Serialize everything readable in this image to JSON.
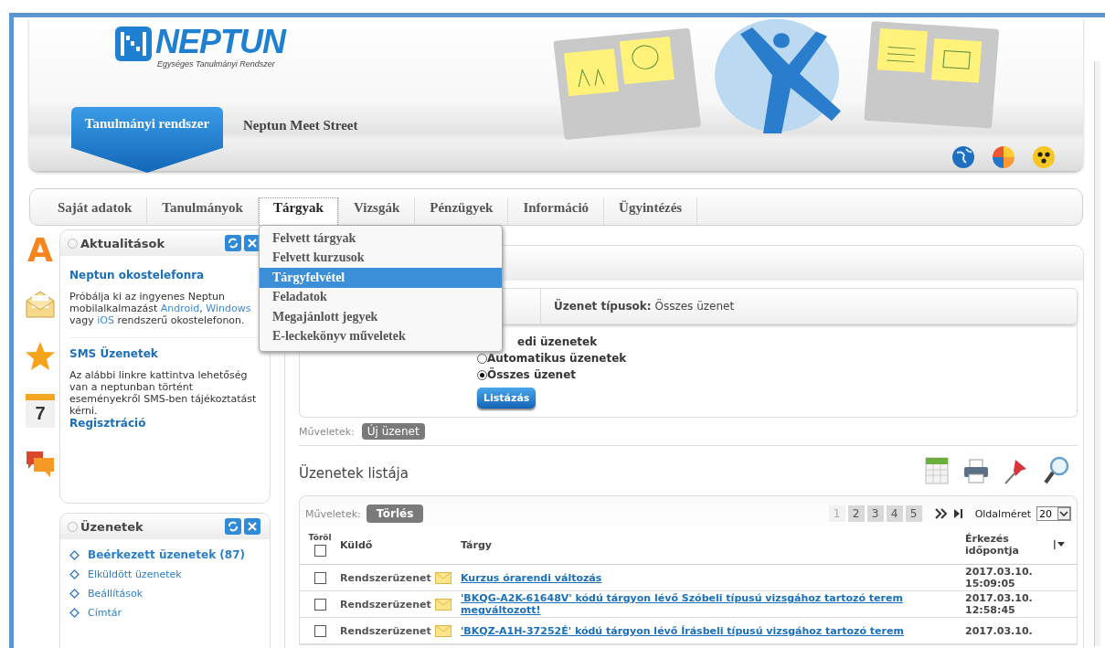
{
  "header": {
    "logo": {
      "name": "NEPTUN",
      "subtitle": "Egységes Tanulmányi Rendszer"
    },
    "tabs": [
      {
        "label": "Tanulmányi rendszer",
        "selected": true
      },
      {
        "label": "Neptun Meet Street",
        "selected": false
      }
    ]
  },
  "nav": {
    "items": [
      {
        "label": "Saját adatok",
        "selected": false
      },
      {
        "label": "Tanulmányok",
        "selected": false
      },
      {
        "label": "Tárgyak",
        "selected": true
      },
      {
        "label": "Vizsgák",
        "selected": false
      },
      {
        "label": "Pénzügyek",
        "selected": false
      },
      {
        "label": "Információ",
        "selected": false
      },
      {
        "label": "Ügyintézés",
        "selected": false
      }
    ],
    "menu": [
      {
        "label": "Felvett tárgyak",
        "selected": false
      },
      {
        "label": "Felvett kurzusok",
        "selected": false
      },
      {
        "label": "Tárgyfelvétel",
        "selected": true
      },
      {
        "label": "Feladatok",
        "selected": false
      },
      {
        "label": "Megajánlott jegyek",
        "selected": false
      },
      {
        "label": "E-leckekönyv műveletek",
        "selected": false
      }
    ]
  },
  "side_icons": [
    {
      "kind": "letter",
      "text": "A"
    },
    {
      "kind": "envelope"
    },
    {
      "kind": "star"
    },
    {
      "kind": "calendar",
      "text": "7"
    },
    {
      "kind": "chat"
    }
  ],
  "news_panel": {
    "title": "Aktualitások",
    "sections": [
      {
        "title": "Neptun okostelefonra",
        "text": [
          {
            "kind": "text",
            "text": "Próbálja ki az ingyenes Neptun mobilalkalmazást "
          },
          {
            "kind": "link",
            "text": "Android"
          },
          {
            "kind": "text",
            "text": ", "
          },
          {
            "kind": "link",
            "text": "Windows"
          },
          {
            "kind": "text",
            "text": " vagy "
          },
          {
            "kind": "link",
            "text": "iOS"
          },
          {
            "kind": "text",
            "text": " rendszerű okostelefonon."
          }
        ]
      },
      {
        "title": "SMS Üzenetek",
        "text": [
          {
            "kind": "text",
            "text": "Az alábbi linkre kattintva lehetőség van a neptunban történt eseményekről SMS-ben tájékoztatást kérni."
          }
        ],
        "link": "Regisztráció"
      }
    ]
  },
  "messages_panel": {
    "title": "Üzenetek",
    "items": [
      {
        "label": "Beérkezett üzenetek (87)",
        "selected": true
      },
      {
        "label": "Elküldött üzenetek",
        "selected": false
      },
      {
        "label": "Beállítások",
        "selected": false
      },
      {
        "label": "Címtár",
        "selected": false
      }
    ]
  },
  "filter": {
    "label": "Üzenet típusok:",
    "value": "Összes üzenet",
    "partial_option": "edi üzenetek",
    "options": [
      {
        "label": "Automatikus üzenetek",
        "selected": false
      },
      {
        "label": "Összes üzenet",
        "selected": true
      }
    ],
    "button": "Listázás"
  },
  "actions": {
    "label": "Műveletek:",
    "button": "Új üzenet"
  },
  "list": {
    "title": "Üzenetek listája",
    "actions_label": "Műveletek:",
    "delete_button": "Törlés",
    "pages": [
      {
        "label": "1",
        "selected": true
      },
      {
        "label": "2",
        "selected": false
      },
      {
        "label": "3",
        "selected": false
      },
      {
        "label": "4",
        "selected": false
      },
      {
        "label": "5",
        "selected": false
      }
    ],
    "page_size_label": "Oldalméret",
    "page_size": "20",
    "columns": [
      "Töröl",
      "Küldő",
      "Tárgy",
      "Érkezés időpontja"
    ],
    "select_all_checked": false,
    "rows": [
      {
        "checked": false,
        "sender": "Rendszerüzenet",
        "subject": "Kurzus órarendi változás",
        "date": "2017.03.10.",
        "time": "15:09:05"
      },
      {
        "checked": false,
        "sender": "Rendszerüzenet",
        "subject": "'BKQG-A2K-61648V' kódú tárgyon lévő Szóbeli típusú vizsgához tartozó terem megváltozott!",
        "date": "2017.03.10.",
        "time": "12:58:45"
      },
      {
        "checked": false,
        "sender": "Rendszerüzenet",
        "subject": "'BKQZ-A1H-37252É' kódú tárgyon lévő Írásbeli típusú vizsgához tartozó terem",
        "date": "2017.03.10."
      }
    ]
  }
}
